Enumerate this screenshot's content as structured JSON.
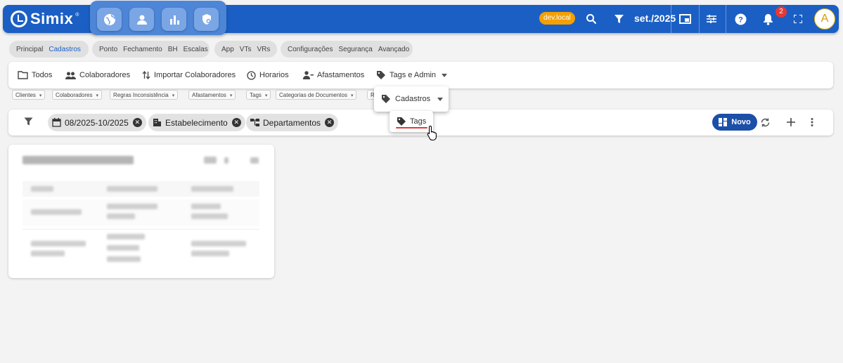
{
  "topbar": {
    "brand": "Simix",
    "brand_sup": "®",
    "modules": [
      "globe-icon",
      "person-icon",
      "bar-chart-icon",
      "shield-icon"
    ],
    "env_badge": "dev.local",
    "period": "set./2025",
    "notifications_count": "2",
    "avatar_letter": "A",
    "colors": {
      "bar": "#1b5fc4",
      "env": "#f4a000",
      "badge": "#e53935"
    }
  },
  "nav": {
    "groups": [
      {
        "items": [
          "Principal",
          "Cadastros"
        ],
        "active": "Cadastros"
      },
      {
        "items": [
          "Ponto",
          "Fechamento",
          "BH",
          "Escalas"
        ]
      },
      {
        "items": [
          "App",
          "VTs",
          "VRs"
        ]
      },
      {
        "items": [
          "Configurações",
          "Segurança",
          "Avançado"
        ]
      }
    ]
  },
  "tabs": [
    "Todos",
    "Colaboradores",
    "Importar Colaboradores",
    "Horarios",
    "Afastamentos",
    "Tags e Admin"
  ],
  "filters": [
    "Clientes",
    "Colaboradores",
    "Regras Inconsistência",
    "Afastamentos",
    "Tags",
    "Categorias de Documentos",
    "R"
  ],
  "filterbar": {
    "chips": [
      "08/2025-10/2025",
      "Estabelecimento",
      "Departamentos"
    ],
    "new_button": "Novo"
  },
  "dropdown": {
    "cadastros": "Cadastros",
    "tags": "Tags"
  }
}
